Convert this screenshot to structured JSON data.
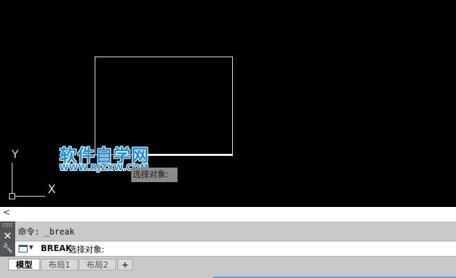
{
  "canvas": {
    "tooltip_text": "选择对象:",
    "ucs": {
      "y_label": "Y",
      "x_label": "X"
    }
  },
  "watermark": {
    "title": "软件自学网",
    "url": "WWW.RJZXW.COM"
  },
  "scrollbar": {
    "left_arrow": "<"
  },
  "command_line": {
    "side": {
      "close": "✕",
      "settings": "🔧"
    },
    "history": "命令: _break",
    "current_command": "BREAK",
    "current_prompt": "选择对象:"
  },
  "layout_tabs": {
    "tabs": [
      {
        "label": "模型",
        "active": true
      },
      {
        "label": "布局1",
        "active": false
      },
      {
        "label": "布局2",
        "active": false
      }
    ],
    "add_label": "+"
  },
  "colors": {
    "canvas_bg": "#000000",
    "watermark": "#1a8fe0",
    "command_bar": "#c9c9c9"
  }
}
